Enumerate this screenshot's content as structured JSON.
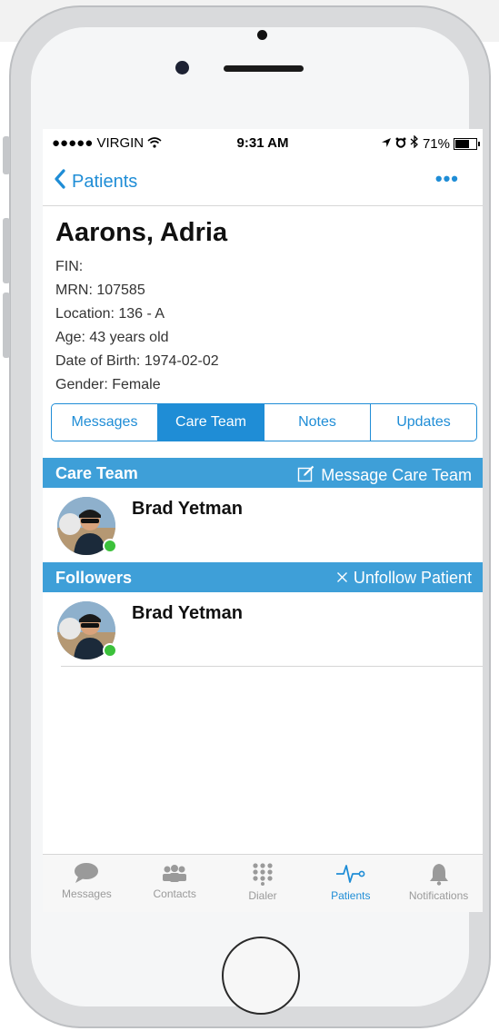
{
  "status_bar": {
    "carrier": "●●●●● VIRGIN",
    "time": "9:31 AM",
    "battery": "71%",
    "battery_level": 0.71
  },
  "nav": {
    "back_label": "Patients",
    "more_label": "•••"
  },
  "patient": {
    "name": "Aarons, Adria",
    "fin": "FIN:",
    "mrn": "MRN: 107585",
    "location": "Location: 136 - A",
    "age": "Age: 43 years old",
    "dob": "Date of Birth: 1974-02-02",
    "gender": "Gender: Female"
  },
  "segments": [
    {
      "label": "Messages",
      "active": false
    },
    {
      "label": "Care Team",
      "active": true
    },
    {
      "label": "Notes",
      "active": false
    },
    {
      "label": "Updates",
      "active": false
    }
  ],
  "care_team": {
    "title": "Care Team",
    "action": "Message Care Team",
    "members": [
      {
        "name": "Brad Yetman",
        "status": "online"
      }
    ]
  },
  "followers": {
    "title": "Followers",
    "action": "Unfollow Patient",
    "members": [
      {
        "name": "Brad Yetman",
        "status": "online"
      }
    ]
  },
  "tab_bar": [
    {
      "label": "Messages",
      "icon": "chat-bubble-icon",
      "active": false
    },
    {
      "label": "Contacts",
      "icon": "people-icon",
      "active": false
    },
    {
      "label": "Dialer",
      "icon": "keypad-icon",
      "active": false
    },
    {
      "label": "Patients",
      "icon": "pulse-icon",
      "active": true
    },
    {
      "label": "Notifications",
      "icon": "bell-icon",
      "active": false
    }
  ],
  "colors": {
    "accent": "#1f8dd6",
    "section_header": "#3e9fd8",
    "online": "#3cc13b",
    "tab_inactive": "#9a9a9a"
  }
}
